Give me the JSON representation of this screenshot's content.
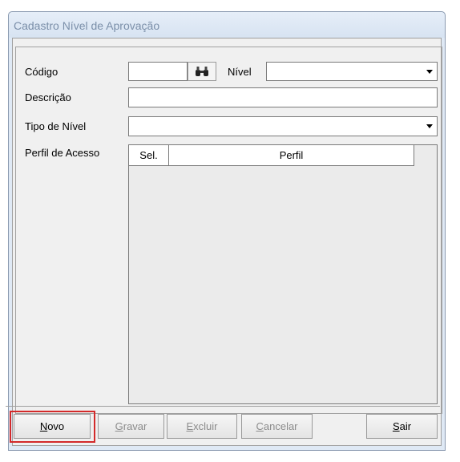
{
  "window": {
    "title": "Cadastro Nível de Aprovação"
  },
  "form": {
    "codigo_label": "Código",
    "codigo_value": "",
    "nivel_label": "Nível",
    "nivel_value": "",
    "descricao_label": "Descrição",
    "descricao_value": "",
    "tipo_nivel_label": "Tipo de Nível",
    "tipo_nivel_value": "",
    "perfil_label": "Perfil de Acesso"
  },
  "grid": {
    "columns": [
      "Sel.",
      "Perfil"
    ],
    "rows": []
  },
  "buttons": {
    "novo": {
      "label": "Novo",
      "mnemonic": "N",
      "rest": "ovo"
    },
    "gravar": {
      "label": "Gravar",
      "mnemonic": "G",
      "rest": "ravar"
    },
    "excluir": {
      "label": "Excluir",
      "mnemonic": "E",
      "rest": "xcluir"
    },
    "cancelar": {
      "label": "Cancelar",
      "mnemonic": "C",
      "rest": "ancelar"
    },
    "sair": {
      "label": "Sair",
      "mnemonic": "S",
      "rest": "air"
    }
  },
  "icons": {
    "search": "binoculars-icon",
    "dropdown": "chevron-down-icon"
  },
  "colors": {
    "highlight": "#d32a2a",
    "titlebar_text": "#7b8fa9",
    "disabled_text": "#8c8c8c"
  }
}
